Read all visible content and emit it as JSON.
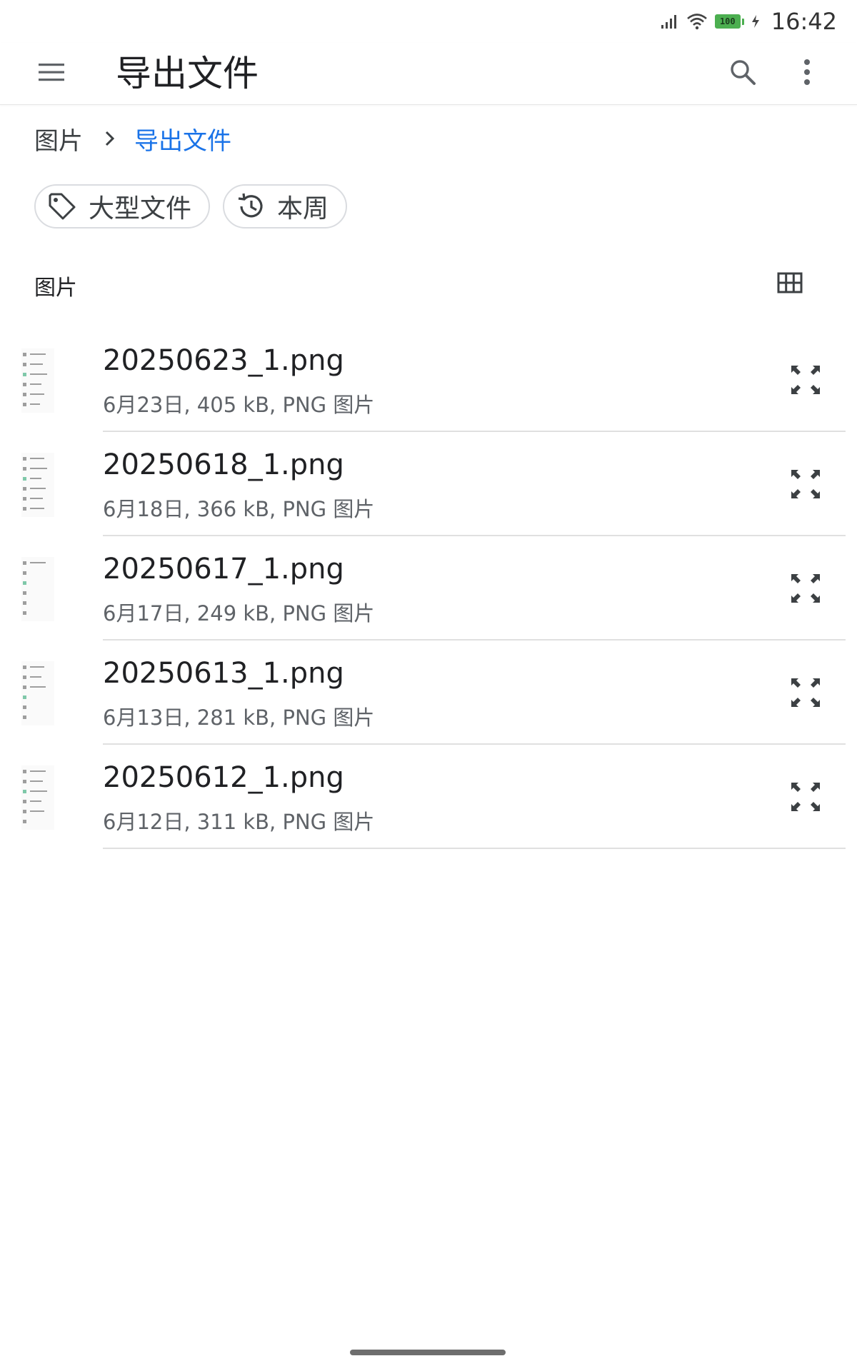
{
  "status_bar": {
    "battery_level": "100",
    "time": "16:42",
    "icons": [
      "signal-icon",
      "wifi-icon",
      "battery-icon",
      "charging-icon"
    ]
  },
  "app_bar": {
    "title": "导出文件",
    "icons": [
      "menu-icon",
      "search-icon",
      "more-vert-icon"
    ]
  },
  "breadcrumb": {
    "root": "图片",
    "current": "导出文件",
    "current_color": "#1a73e8"
  },
  "chips": [
    {
      "label": "大型文件",
      "icon": "label-tag-icon"
    },
    {
      "label": "本周",
      "icon": "history-icon"
    }
  ],
  "section": {
    "title": "图片",
    "view_icon": "grid-view-icon"
  },
  "files": [
    {
      "name": "20250623_1.png",
      "meta": "6月23日, 405 kB, PNG 图片"
    },
    {
      "name": "20250618_1.png",
      "meta": "6月18日, 366 kB, PNG 图片"
    },
    {
      "name": "20250617_1.png",
      "meta": "6月17日, 249 kB, PNG 图片"
    },
    {
      "name": "20250613_1.png",
      "meta": "6月13日, 281 kB, PNG 图片"
    },
    {
      "name": "20250612_1.png",
      "meta": "6月12日, 311 kB, PNG 图片"
    }
  ]
}
